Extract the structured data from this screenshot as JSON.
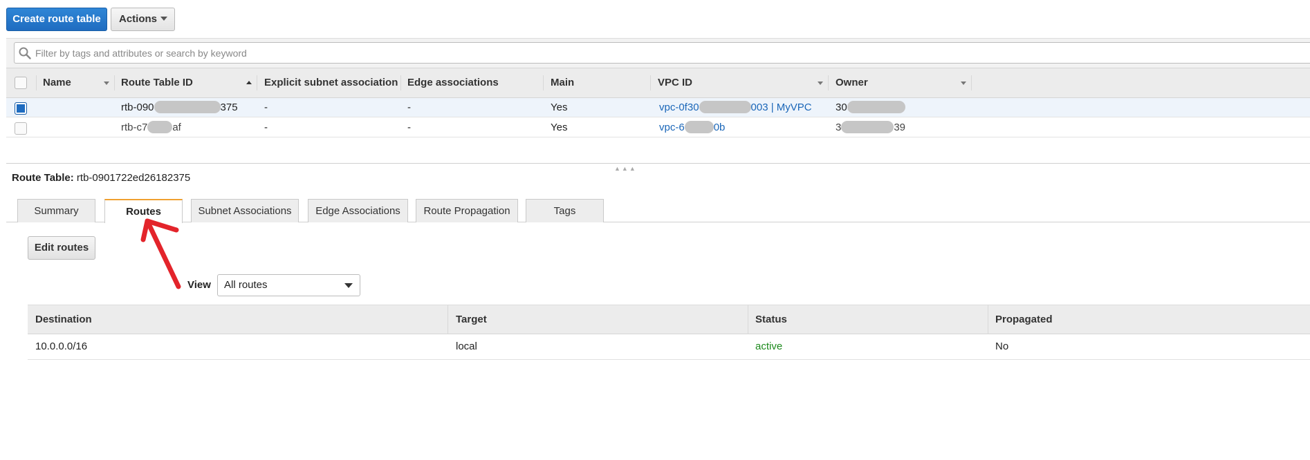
{
  "toolbar": {
    "create_label": "Create route table",
    "actions_label": "Actions"
  },
  "search": {
    "placeholder": "Filter by tags and attributes or search by keyword"
  },
  "table": {
    "columns": [
      "Name",
      "Route Table ID",
      "Explicit subnet association",
      "Edge associations",
      "Main",
      "VPC ID",
      "Owner"
    ],
    "rows": [
      {
        "selected": true,
        "name": "",
        "id_prefix": "rtb-090",
        "id_suffix": "375",
        "explicit": "-",
        "edge": "-",
        "main": "Yes",
        "vpc_prefix": "vpc-0f30",
        "vpc_suffix": "003 | MyVPC",
        "owner_prefix": "30",
        "owner_suffix": ""
      },
      {
        "selected": false,
        "name": "",
        "id_prefix": "rtb-c7",
        "id_suffix": "af",
        "explicit": "-",
        "edge": "-",
        "main": "Yes",
        "vpc_prefix": "vpc-6",
        "vpc_suffix": "0b",
        "owner_prefix": "3",
        "owner_suffix": "39"
      }
    ]
  },
  "detail": {
    "label": "Route Table:",
    "value": "rtb-0901722ed26182375"
  },
  "tabs": [
    "Summary",
    "Routes",
    "Subnet Associations",
    "Edge Associations",
    "Route Propagation",
    "Tags"
  ],
  "routes": {
    "edit_label": "Edit routes",
    "view_label": "View",
    "view_value": "All routes",
    "columns": [
      "Destination",
      "Target",
      "Status",
      "Propagated"
    ],
    "rows": [
      {
        "destination": "10.0.0.0/16",
        "target": "local",
        "status": "active",
        "propagated": "No"
      }
    ]
  },
  "colors": {
    "primary": "#1f6cc0",
    "link": "#1a66b8",
    "active": "#1d8a1d",
    "tab_accent": "#f0a030",
    "annotation_arrow": "#e3242b"
  }
}
